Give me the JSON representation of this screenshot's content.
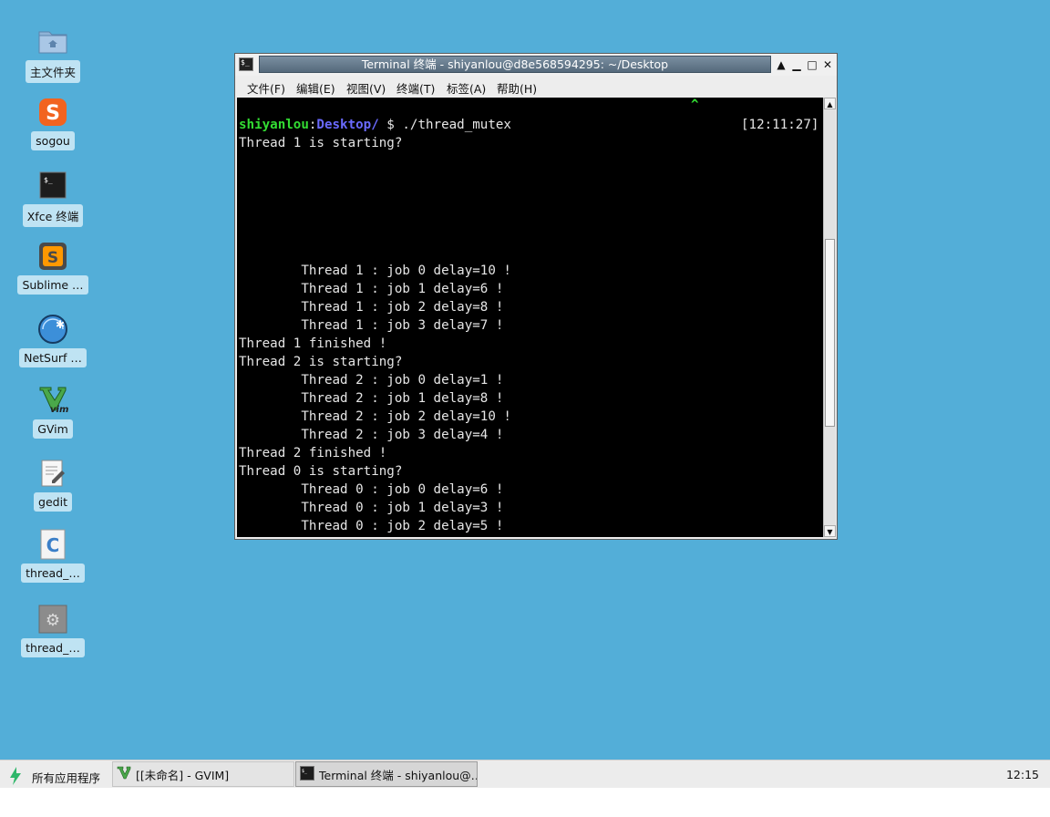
{
  "desktop_icons": [
    {
      "label": "主文件夹",
      "icon": "home-folder-icon"
    },
    {
      "label": "sogou",
      "icon": "sogou-icon"
    },
    {
      "label": "Xfce 终端",
      "icon": "terminal-icon"
    },
    {
      "label": "Sublime …",
      "icon": "sublime-icon"
    },
    {
      "label": "NetSurf …",
      "icon": "netsurf-icon"
    },
    {
      "label": "GVim",
      "icon": "gvim-icon"
    },
    {
      "label": "gedit",
      "icon": "gedit-icon"
    },
    {
      "label": "thread_…",
      "icon": "c-source-file-icon"
    },
    {
      "label": "thread_…",
      "icon": "executable-file-icon"
    }
  ],
  "window": {
    "title": "Terminal 终端 - shiyanlou@d8e568594295: ~/Desktop",
    "menu": [
      "文件(F)",
      "编辑(E)",
      "视图(V)",
      "终端(T)",
      "标签(A)",
      "帮助(H)"
    ],
    "controls": [
      "▲",
      "▁",
      "□",
      "✕"
    ]
  },
  "terminal": {
    "caret_glyph": "^",
    "prompt_user": "shiyanlou",
    "prompt_sep": ":",
    "prompt_dir": "Desktop/",
    "prompt_cmd": " $ ./thread_mutex",
    "prompt_time": "[12:11:27]",
    "colors": {
      "user": "#33dd33",
      "dir": "#6a6aff",
      "caret": "#33dd33",
      "text": "#e6e6e6",
      "bg": "#000000"
    },
    "lines": [
      "Thread 1 is starting?",
      "",
      "",
      "",
      "",
      "",
      "",
      "        Thread 1 : job 0 delay=10 !",
      "        Thread 1 : job 1 delay=6 !",
      "        Thread 1 : job 2 delay=8 !",
      "        Thread 1 : job 3 delay=7 !",
      "Thread 1 finished !",
      "Thread 2 is starting?",
      "        Thread 2 : job 0 delay=1 !",
      "        Thread 2 : job 1 delay=8 !",
      "        Thread 2 : job 2 delay=10 !",
      "        Thread 2 : job 3 delay=4 !",
      "Thread 2 finished !",
      "Thread 0 is starting?",
      "        Thread 0 : job 0 delay=6 !",
      "        Thread 0 : job 1 delay=3 !",
      "        Thread 0 : job 2 delay=5 !"
    ]
  },
  "taskbar": {
    "start_label": "所有应用程序",
    "tasks": [
      {
        "label": "[[未命名] - GVIM]",
        "icon": "gvim-icon",
        "active": false
      },
      {
        "label": "Terminal 终端 - shiyanlou@…",
        "icon": "terminal-icon",
        "active": true
      }
    ],
    "clock": "12:15"
  }
}
